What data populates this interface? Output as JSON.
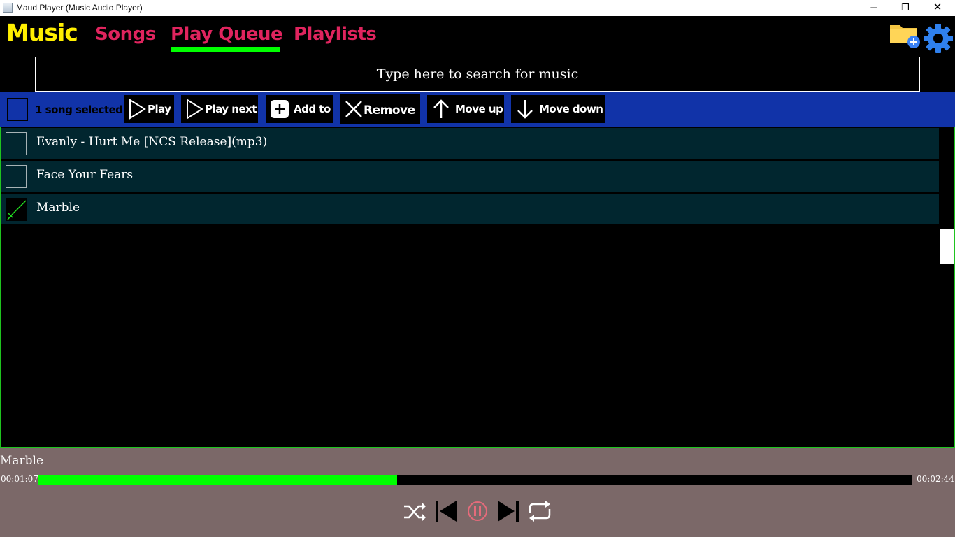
{
  "window": {
    "title": "Maud Player (Music Audio Player)",
    "controls": {
      "minimize": "─",
      "maximize": "❐",
      "close": "✕"
    }
  },
  "nav": {
    "brand": "Music",
    "tabs": [
      {
        "label": "Songs",
        "active": false
      },
      {
        "label": "Play Queue",
        "active": true
      },
      {
        "label": "Playlists",
        "active": false
      }
    ],
    "actions": {
      "add_folder_icon": "folder-add-icon",
      "settings_icon": "gear-icon"
    }
  },
  "search": {
    "placeholder": "Type here to search for music",
    "value": ""
  },
  "toolbar": {
    "selection_text": "1 song selected",
    "buttons": {
      "play": "Play",
      "play_next": "Play next",
      "add_to": "Add to",
      "remove": "Remove",
      "move_up": "Move up",
      "move_down": "Move down"
    }
  },
  "queue": [
    {
      "title": "Evanly - Hurt Me [NCS Release](mp3)",
      "checked": false
    },
    {
      "title": "Face Your Fears",
      "checked": false
    },
    {
      "title": "Marble",
      "checked": true
    }
  ],
  "player": {
    "now_playing": "Marble",
    "current_time": "00:01:07",
    "total_time": "00:02:44",
    "progress": 0.41,
    "state": "playing",
    "controls": [
      "shuffle-icon",
      "previous-icon",
      "pause-icon",
      "next-icon",
      "repeat-icon"
    ]
  },
  "colors": {
    "brand": "#ffef00",
    "tab": "#e0245e",
    "accent_green": "#00ff00",
    "toolbar_bg": "#1133a8",
    "row_bg": "#01262f",
    "player_bg": "#7b6868",
    "pause_button": "#e56b7b"
  }
}
